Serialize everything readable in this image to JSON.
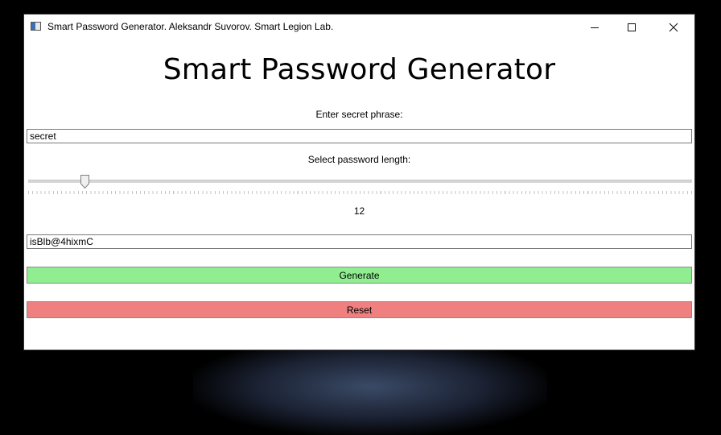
{
  "window": {
    "title": "Smart Password Generator. Aleksandr Suvorov. Smart Legion Lab.",
    "icons": {
      "app": "app-icon",
      "minimize": "minimize-icon",
      "maximize": "maximize-icon",
      "close": "close-icon"
    },
    "close_glyph": "✕"
  },
  "main": {
    "heading": "Smart Password Generator",
    "phrase_label": "Enter secret phrase:",
    "phrase_value": "secret",
    "length_label": "Select password length:",
    "length_value": "12",
    "length_fraction": 0.085,
    "password_value": "isBlb@4hixmC",
    "generate_label": "Generate",
    "reset_label": "Reset"
  },
  "colors": {
    "generate": "#90ee90",
    "reset": "#f08080",
    "window_bg": "#ffffff",
    "desktop_bg": "#000000"
  }
}
